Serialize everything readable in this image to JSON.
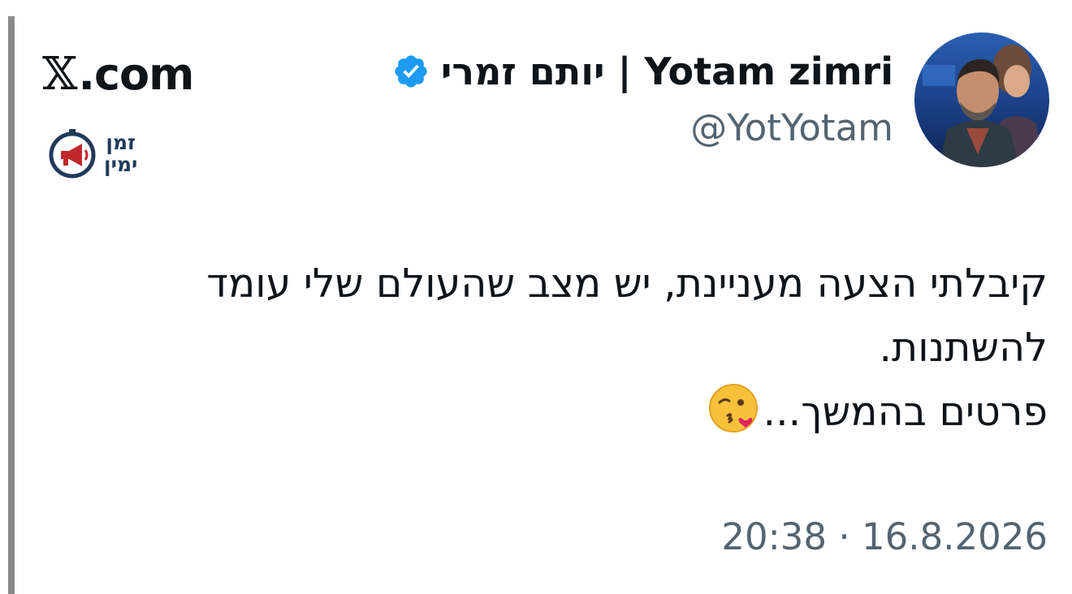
{
  "site": {
    "logo_glyph": "𝕏",
    "logo_suffix": ".com"
  },
  "brand_badge": {
    "line1": "זמן",
    "line2": "ימין",
    "icon": "megaphone-clock-icon",
    "color": "#1f3a5a",
    "accent": "#c0282d"
  },
  "author": {
    "display_name": "יותם זמרי | Yotam zimri",
    "handle": "@YotYotam",
    "verified": true,
    "verified_color": "#1d9bf0",
    "avatar_icon": "profile-photo"
  },
  "tweet": {
    "lines": [
      "קיבלתי הצעה מעניינת, יש מצב שהעולם שלי עומד",
      "להשתנות.",
      "פרטים בהמשך..."
    ],
    "emoji": "face-blowing-a-kiss-icon",
    "timestamp": "20:38 · 16.8.2026"
  },
  "colors": {
    "text": "#0f1419",
    "secondary": "#536471",
    "left_bar": "#8a8a8a"
  }
}
